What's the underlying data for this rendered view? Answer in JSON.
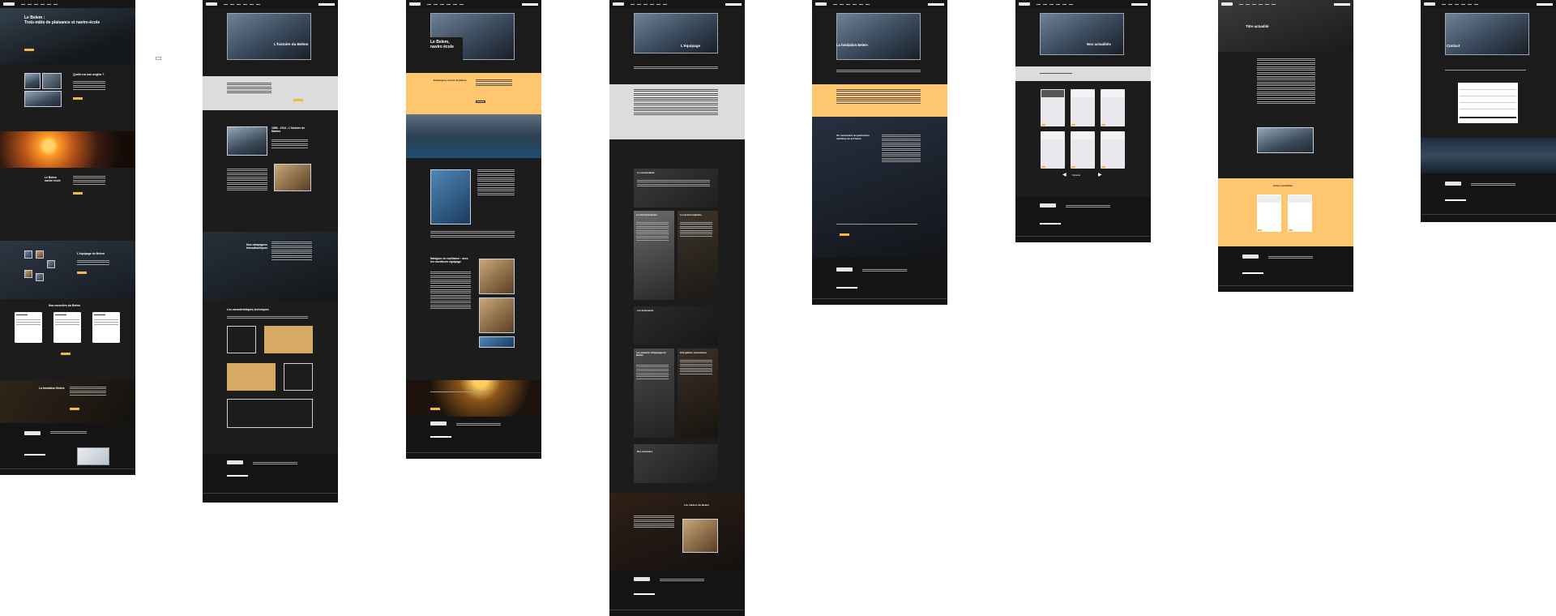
{
  "site": {
    "name": "BELEM"
  },
  "pages": [
    {
      "id": "home",
      "hero_title": "Le Belem :\nTrois-mâts de plaisance et navire-école",
      "sections": {
        "origins": "Quelle est son origine ?",
        "sail": "Le Belem\nnavire école",
        "crew": "L'équipage du Belem",
        "news": "Nos nouvelles du Belem",
        "foundation": "La fondation Belem"
      },
      "news_cards": [
        "Au fil de la découverte",
        "Le fer et son parcours",
        "Rencontres jeunes"
      ]
    },
    {
      "id": "history",
      "hero_title": "L'histoire du Belem",
      "sections": {
        "era": "1896 - 1914 : L'histoire de Nantes",
        "campaigns": "Nos campagnes transatlantiques",
        "specs": "Les caractéristiques techniques"
      }
    },
    {
      "id": "school",
      "hero_title": "Le Belem,\nnavire école",
      "sections": {
        "embark": "Embarquez à bord du Belem",
        "navigate": "Naviguer en confiance : avec les moniteurs équipage"
      }
    },
    {
      "id": "crew",
      "hero_title": "L'équipage",
      "sections": {
        "captain": "Le commandant",
        "second": "Le chef mécanicien",
        "second_cap": "Le second capitaine",
        "boatswains": "Les lieutenants",
        "sailors": "Les matelots d'équipage du Belem",
        "instructors": "Huit gabiers instructeurs",
        "cooks": "Nos cuisiniers",
        "trades": "Les métiers du Belem"
      }
    },
    {
      "id": "foundation",
      "hero_title": "La fondation Belem",
      "sections": {
        "heritage": "Un monument du patrimoine maritime de la France"
      }
    },
    {
      "id": "news",
      "hero_title": "Nos actualités",
      "pagination": "Suivante"
    },
    {
      "id": "article",
      "hero_title": "Titre actualité",
      "sections": {
        "more": "Autres actualités"
      }
    },
    {
      "id": "contact",
      "hero_title": "Contact"
    }
  ]
}
